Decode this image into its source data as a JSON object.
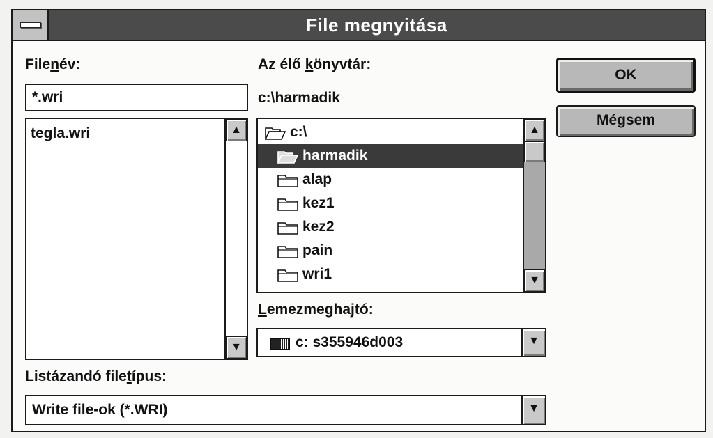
{
  "window": {
    "title": "File megnyitása"
  },
  "filename": {
    "label_pre": "File",
    "label_key": "n",
    "label_post": "év:",
    "value": "*.wri",
    "files": [
      "tegla.wri"
    ]
  },
  "directory": {
    "label_pre": "Az élő ",
    "label_key": "k",
    "label_post": "önyvtár:",
    "current_path": "c:\\harmadik",
    "tree": [
      {
        "name": "c:\\",
        "icon": "open-folder-icon",
        "selected": false
      },
      {
        "name": "harmadik",
        "icon": "open-folder-icon",
        "selected": true
      },
      {
        "name": "alap",
        "icon": "folder-icon",
        "selected": false
      },
      {
        "name": "kez1",
        "icon": "folder-icon",
        "selected": false
      },
      {
        "name": "kez2",
        "icon": "folder-icon",
        "selected": false
      },
      {
        "name": "pain",
        "icon": "folder-icon",
        "selected": false
      },
      {
        "name": "wri1",
        "icon": "folder-icon",
        "selected": false
      }
    ]
  },
  "drive": {
    "label_key": "L",
    "label_post": "emezmeghajtó:",
    "value": "c: s355946d003",
    "icon": "drive-icon"
  },
  "filetype": {
    "label_pre": "Listázandó file",
    "label_key": "t",
    "label_post": "ípus:",
    "value": "Write file-ok (*.WRI)"
  },
  "buttons": {
    "ok": "OK",
    "cancel": "Mégsem"
  },
  "glyphs": {
    "up": "▲",
    "down": "▼"
  },
  "colors": {
    "titlebar": "#4b4b4b",
    "selection": "#3a3a3a",
    "button_face": "#b8b8b8"
  }
}
